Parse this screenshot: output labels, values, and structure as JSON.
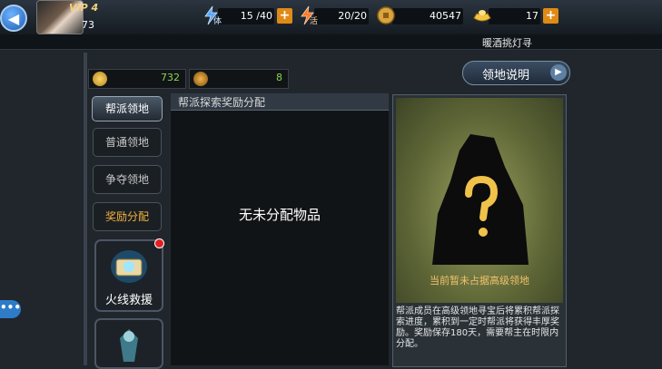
{
  "topbar": {
    "vip_label": "VIP 4",
    "player_level": "73",
    "stamina": "15 /40",
    "stamina_label": "体",
    "energy": "20/20",
    "energy_label": "活",
    "coins": "40547",
    "gold": "17",
    "plus": "+"
  },
  "ticker": "暖酒挑灯寻",
  "counters": {
    "currency_a": "732",
    "currency_b": "8"
  },
  "info_button": "领地说明",
  "menu": {
    "active": "帮派领地",
    "items": [
      "普通领地",
      "争夺领地",
      "奖励分配"
    ],
    "tile_rescue": "火线救援"
  },
  "panel": {
    "title": "帮派探索奖励分配",
    "empty_text": "无未分配物品"
  },
  "card": {
    "caption": "当前暂未占据高级领地",
    "description": "帮派成员在高级领地寻宝后将累积帮派探索进度，累积到一定时帮派将获得丰厚奖励。奖励保存180天，需要帮主在时限内分配。"
  },
  "colors": {
    "highlight": "#f2b03c",
    "counter_value": "#8bd34c",
    "accent_blue": "#2e7bc8"
  }
}
